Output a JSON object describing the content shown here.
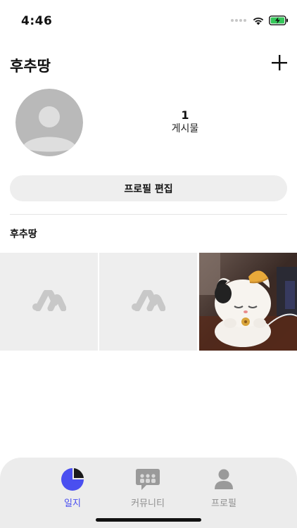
{
  "status_bar": {
    "time": "4:46"
  },
  "header": {
    "title": "후추땅",
    "add_icon": "plus-icon"
  },
  "profile": {
    "avatar_icon": "default-avatar-icon",
    "post_count": "1",
    "post_label": "게시물",
    "edit_button_label": "프로필 편집"
  },
  "section": {
    "title": "후추땅"
  },
  "grid": {
    "tiles": [
      {
        "kind": "placeholder",
        "icon": "app-logo-placeholder-icon"
      },
      {
        "kind": "placeholder",
        "icon": "app-logo-placeholder-icon"
      },
      {
        "kind": "photo",
        "subject": "white cat plush toy photo"
      }
    ]
  },
  "tab_bar": {
    "tabs": [
      {
        "label": "일지",
        "icon": "pie-chart-icon",
        "active": true
      },
      {
        "label": "커뮤니티",
        "icon": "chat-bubble-icon",
        "active": false
      },
      {
        "label": "프로필",
        "icon": "person-icon",
        "active": false
      }
    ]
  },
  "colors": {
    "accent": "#4a4ff0",
    "tab_bar_bg": "#ececec",
    "placeholder_bg": "#eeeeee",
    "battery": "#34c759"
  }
}
